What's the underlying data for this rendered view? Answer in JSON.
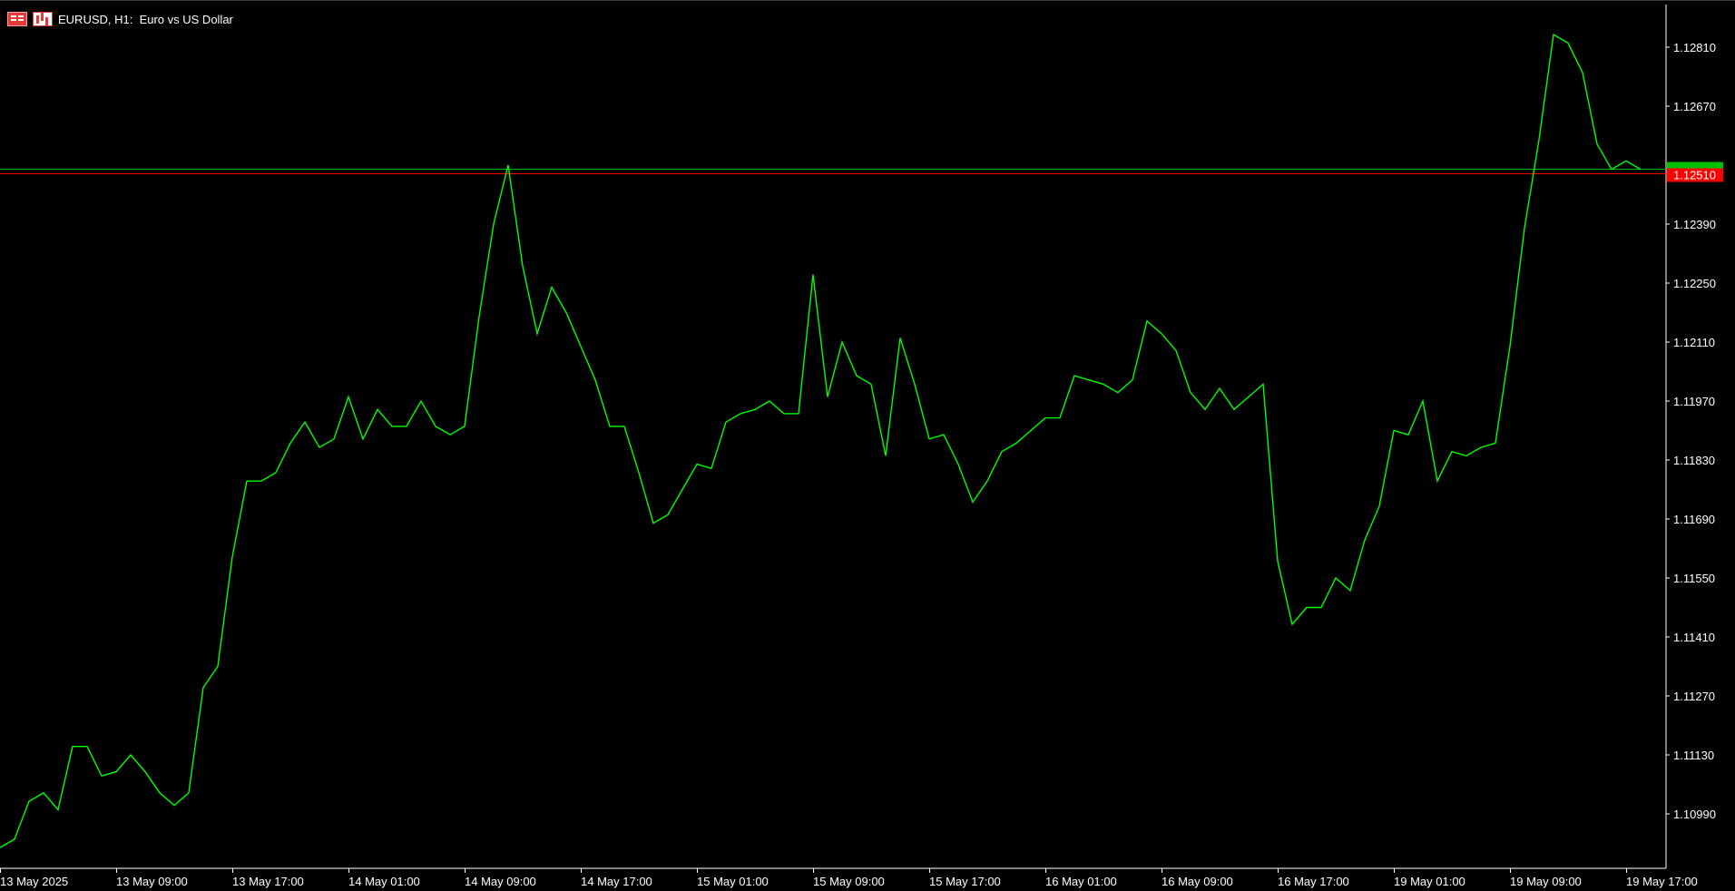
{
  "window": {
    "title": "EURUSD, H1:  Euro vs US Dollar",
    "icons": [
      "list-icon",
      "chart-icon"
    ]
  },
  "colors": {
    "background": "#000000",
    "line": "#00ff00",
    "bid_line": "#ff0000",
    "ask_line": "#00c000",
    "axis": "#ffffff",
    "text": "#ffffff"
  },
  "price_axis": {
    "labels": [
      "1.12810",
      "1.12670",
      "1.12390",
      "1.12250",
      "1.12110",
      "1.11970",
      "1.11830",
      "1.11690",
      "1.11550",
      "1.11410",
      "1.11270",
      "1.11130",
      "1.10990"
    ],
    "current_bid": "1.12510"
  },
  "time_axis": {
    "labels": [
      "13 May 2025",
      "13 May 09:00",
      "13 May 17:00",
      "14 May 01:00",
      "14 May 09:00",
      "14 May 17:00",
      "15 May 01:00",
      "15 May 09:00",
      "15 May 17:00",
      "16 May 01:00",
      "16 May 09:00",
      "16 May 17:00",
      "19 May 01:00",
      "19 May 09:00",
      "19 May 17:00"
    ]
  },
  "chart_data": {
    "type": "line",
    "symbol": "EURUSD",
    "timeframe": "H1",
    "ylim": [
      1.1088,
      1.129
    ],
    "bid": 1.1251,
    "ask": 1.12522,
    "grid": false,
    "series": [
      {
        "values": [
          1.1091,
          1.1093,
          1.1102,
          1.1104,
          1.11,
          1.1115,
          1.1115,
          1.1108,
          1.1109,
          1.1113,
          1.1109,
          1.1104,
          1.1101,
          1.1104,
          1.1129,
          1.1134,
          1.116,
          1.1178,
          1.1178,
          1.118,
          1.1187,
          1.1192,
          1.1186,
          1.1188,
          1.1198,
          1.1188,
          1.1195,
          1.1191,
          1.1191,
          1.1197,
          1.1191,
          1.1189,
          1.1191,
          1.1217,
          1.1239,
          1.1253,
          1.1229,
          1.1213,
          1.1224,
          1.1218,
          1.121,
          1.1202,
          1.1191,
          1.1191,
          1.118,
          1.1168,
          1.117,
          1.1176,
          1.1182,
          1.1181,
          1.1192,
          1.1194,
          1.1195,
          1.1197,
          1.1194,
          1.1194,
          1.1227,
          1.1198,
          1.1211,
          1.1203,
          1.1201,
          1.1184,
          1.1212,
          1.1201,
          1.1188,
          1.1189,
          1.1182,
          1.1173,
          1.1178,
          1.1185,
          1.1187,
          1.119,
          1.1193,
          1.1193,
          1.1203,
          1.1202,
          1.1201,
          1.1199,
          1.1202,
          1.1216,
          1.1213,
          1.1209,
          1.1199,
          1.1195,
          1.12,
          1.1195,
          1.1198,
          1.1201,
          1.1159,
          1.1144,
          1.1148,
          1.1148,
          1.1155,
          1.1152,
          1.1164,
          1.1172,
          1.119,
          1.1189,
          1.1197,
          1.1178,
          1.1185,
          1.1184,
          1.1186,
          1.1187,
          1.121,
          1.1238,
          1.1259,
          1.1284,
          1.1282,
          1.1275,
          1.1258,
          1.1252,
          1.1254,
          1.1252
        ]
      }
    ],
    "x_tick_labels": [
      "13 May 2025",
      "13 May 09:00",
      "13 May 17:00",
      "14 May 01:00",
      "14 May 09:00",
      "14 May 17:00",
      "15 May 01:00",
      "15 May 09:00",
      "15 May 17:00",
      "16 May 01:00",
      "16 May 09:00",
      "16 May 17:00",
      "19 May 01:00",
      "19 May 09:00",
      "19 May 17:00"
    ],
    "y_tick_labels": [
      "1.12810",
      "1.12670",
      "1.12390",
      "1.12250",
      "1.12110",
      "1.11970",
      "1.11830",
      "1.11690",
      "1.11550",
      "1.11410",
      "1.11270",
      "1.11130",
      "1.10990"
    ]
  }
}
